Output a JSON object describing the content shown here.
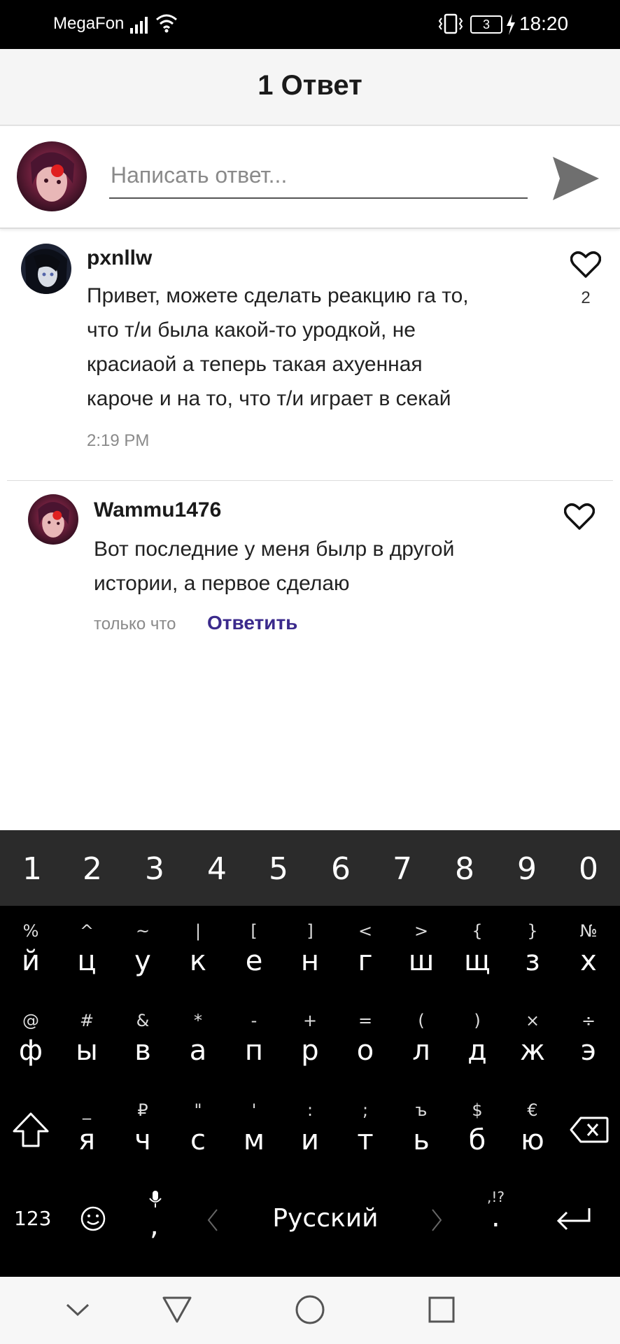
{
  "status_bar": {
    "carrier": "MegaFon",
    "battery": "3",
    "time": "18:20"
  },
  "header": {
    "title": "1 Ответ"
  },
  "reply_bar": {
    "placeholder": "Написать ответ..."
  },
  "comments": [
    {
      "username": "pxnllw",
      "lines": [
        "Привет, можете сделать реакцию га то,",
        "что т/и была какой-то уродкой, не",
        "красиаой а теперь такая ахуенная",
        "кароче и на то, что т/и играет в секай"
      ],
      "time": "2:19 PM",
      "likes": "2"
    },
    {
      "username": "Wammu1476",
      "lines": [
        "Вот последние у меня былр в другой",
        "истории, а первое сделаю"
      ],
      "time": "только что",
      "reply_label": "Ответить"
    }
  ],
  "keyboard": {
    "numbers": [
      "1",
      "2",
      "3",
      "4",
      "5",
      "6",
      "7",
      "8",
      "9",
      "0"
    ],
    "row1": [
      {
        "sec": "%",
        "pri": "й"
      },
      {
        "sec": "^",
        "pri": "ц"
      },
      {
        "sec": "~",
        "pri": "у"
      },
      {
        "sec": "|",
        "pri": "к"
      },
      {
        "sec": "[",
        "pri": "е"
      },
      {
        "sec": "]",
        "pri": "н"
      },
      {
        "sec": "<",
        "pri": "г"
      },
      {
        "sec": ">",
        "pri": "ш"
      },
      {
        "sec": "{",
        "pri": "щ"
      },
      {
        "sec": "}",
        "pri": "з"
      },
      {
        "sec": "№",
        "pri": "х"
      }
    ],
    "row2": [
      {
        "sec": "@",
        "pri": "ф"
      },
      {
        "sec": "#",
        "pri": "ы"
      },
      {
        "sec": "&",
        "pri": "в"
      },
      {
        "sec": "*",
        "pri": "а"
      },
      {
        "sec": "-",
        "pri": "п"
      },
      {
        "sec": "+",
        "pri": "р"
      },
      {
        "sec": "=",
        "pri": "о"
      },
      {
        "sec": "(",
        "pri": "л"
      },
      {
        "sec": ")",
        "pri": "д"
      },
      {
        "sec": "×",
        "pri": "ж"
      },
      {
        "sec": "÷",
        "pri": "э"
      }
    ],
    "row3": [
      {
        "sec": "_",
        "pri": "я"
      },
      {
        "sec": "₽",
        "pri": "ч"
      },
      {
        "sec": "\"",
        "pri": "с"
      },
      {
        "sec": "'",
        "pri": "м"
      },
      {
        "sec": ":",
        "pri": "и"
      },
      {
        "sec": ";",
        "pri": "т"
      },
      {
        "sec": "ъ",
        "pri": "ь"
      },
      {
        "sec": "$",
        "pri": "б"
      },
      {
        "sec": "€",
        "pri": "ю"
      }
    ],
    "symbols_label": "123",
    "comma": ",",
    "space_label": "Русский",
    "punct_sec": ",!?",
    "period": "."
  },
  "icons": {
    "send": "send-icon",
    "like": "heart-icon",
    "shift": "shift-icon",
    "backspace": "backspace-icon",
    "emoji": "emoji-icon",
    "mic": "mic-icon",
    "enter": "enter-icon",
    "nav": [
      "hide-keyboard-icon",
      "back-icon",
      "home-icon",
      "recents-icon"
    ]
  }
}
